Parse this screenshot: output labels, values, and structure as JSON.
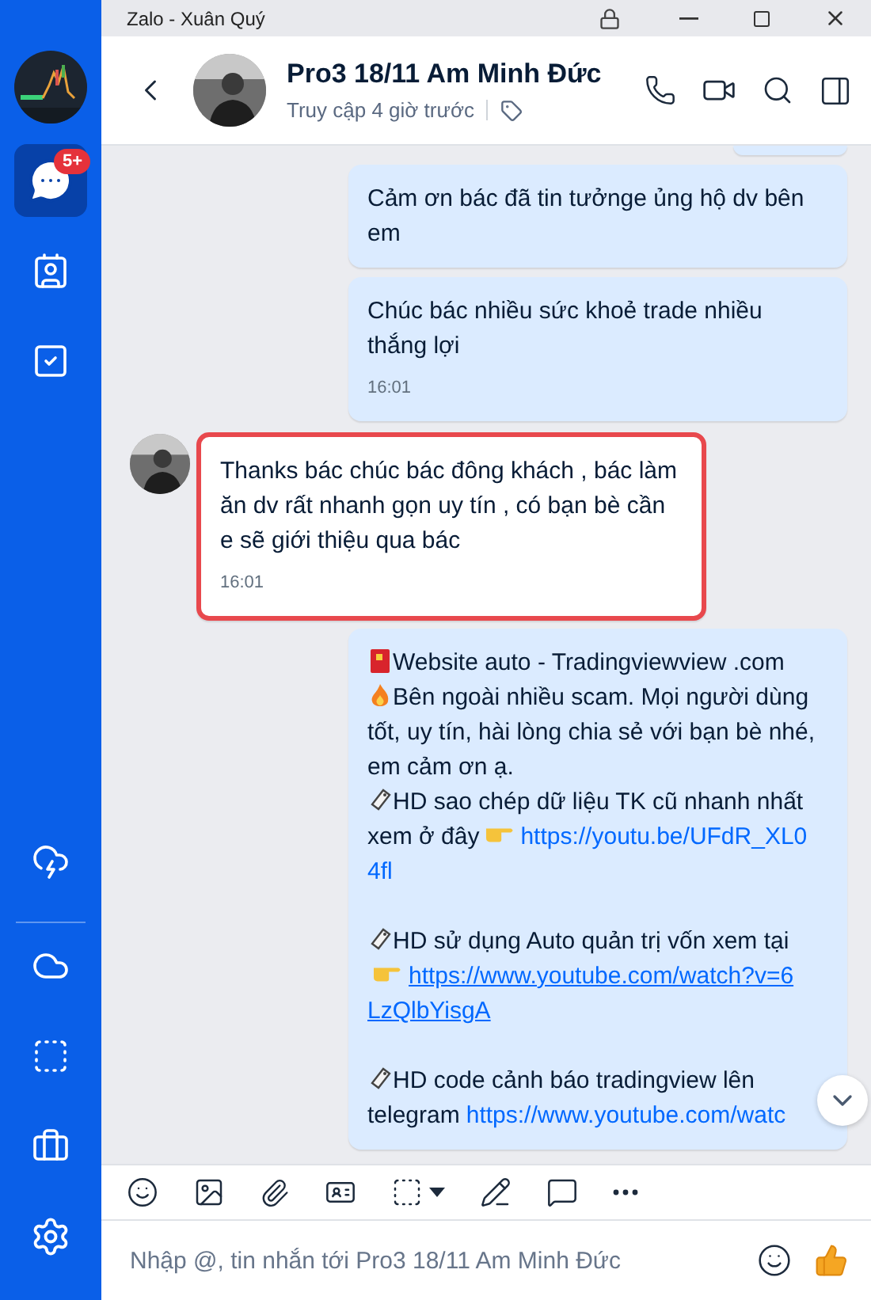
{
  "window": {
    "title": "Zalo - Xuân Quý"
  },
  "sidebar": {
    "items": [
      {
        "kind": "avatar",
        "selected": false
      },
      {
        "kind": "chat",
        "selected": true,
        "badge": "5+"
      },
      {
        "kind": "contacts",
        "selected": false
      },
      {
        "kind": "todo",
        "selected": false
      }
    ],
    "bottom_items": [
      {
        "kind": "zcloud"
      },
      {
        "kind": "cloud"
      },
      {
        "kind": "screenshot"
      },
      {
        "kind": "toolbox"
      },
      {
        "kind": "settings"
      }
    ]
  },
  "conversation": {
    "name": "Pro3 18/11 Am Minh Đức",
    "status": "Truy cập 4 giờ trước"
  },
  "messages": [
    {
      "kind": "fragment",
      "outgoing": true,
      "highlighted": false
    },
    {
      "kind": "text",
      "outgoing": true,
      "highlighted": false,
      "groups": [
        [
          [
            {
              "kind": "text",
              "text": "Cảm ơn bác đã tin tưởnge ủng hộ dv bên em"
            }
          ]
        ]
      ]
    },
    {
      "kind": "text",
      "outgoing": true,
      "highlighted": false,
      "groups": [
        [
          [
            {
              "kind": "text",
              "text": "Chúc bác nhiều sức khoẻ trade nhiều thắng lợi"
            }
          ]
        ]
      ],
      "time": "16:01"
    },
    {
      "kind": "text",
      "outgoing": false,
      "highlighted": true,
      "groups": [
        [
          [
            {
              "kind": "text",
              "text": "Thanks bác chúc bác đông khách , bác làm ăn dv rất nhanh gọn uy tín , có bạn bè cần e sẽ giới thiệu qua bác"
            }
          ]
        ]
      ],
      "time": "16:01"
    },
    {
      "kind": "text",
      "outgoing": true,
      "highlighted": false,
      "groups": [
        [
          [
            {
              "kind": "envelope"
            },
            {
              "kind": "text",
              "text": "Website auto - Tradingviewview .com"
            }
          ],
          [
            {
              "kind": "fire"
            },
            {
              "kind": "text",
              "text": "Bên ngoài nhiều scam. Mọi người dùng"
            }
          ],
          [
            {
              "kind": "text",
              "text": "tốt, uy tín, hài lòng chia sẻ với bạn bè nhé,"
            }
          ],
          [
            {
              "kind": "text",
              "text": "em cảm ơn ạ."
            }
          ],
          [
            {
              "kind": "tag"
            },
            {
              "kind": "text",
              "text": "HD sao chép dữ liệu TK cũ nhanh nhất"
            }
          ],
          [
            {
              "kind": "text",
              "text": "xem ở đây"
            },
            {
              "kind": "pointing-hand"
            },
            {
              "kind": "link",
              "text": "https://youtu.be/UFdR_XL0",
              "underlined": false
            }
          ],
          [
            {
              "kind": "link",
              "text": "4fl",
              "underlined": false
            }
          ]
        ],
        [
          [
            {
              "kind": "tag"
            },
            {
              "kind": "text",
              "text": "HD sử dụng Auto quản trị vốn xem tại"
            }
          ],
          [
            {
              "kind": "pointing-hand"
            },
            {
              "kind": "link",
              "text": "https://www.youtube.com/watch?v=6",
              "underlined": true
            }
          ],
          [
            {
              "kind": "link",
              "text": "LzQlbYisgA",
              "underlined": true
            }
          ]
        ],
        [
          [
            {
              "kind": "tag"
            },
            {
              "kind": "text",
              "text": "HD code cảnh báo tradingview lên"
            }
          ],
          [
            {
              "kind": "text",
              "text": "telegram"
            },
            {
              "kind": "link",
              "text": "https://www.youtube.com/watc",
              "underlined": false
            }
          ]
        ]
      ]
    }
  ],
  "composer": {
    "placeholder": "Nhập @, tin nhắn tới Pro3 18/11 Am Minh Đức"
  }
}
